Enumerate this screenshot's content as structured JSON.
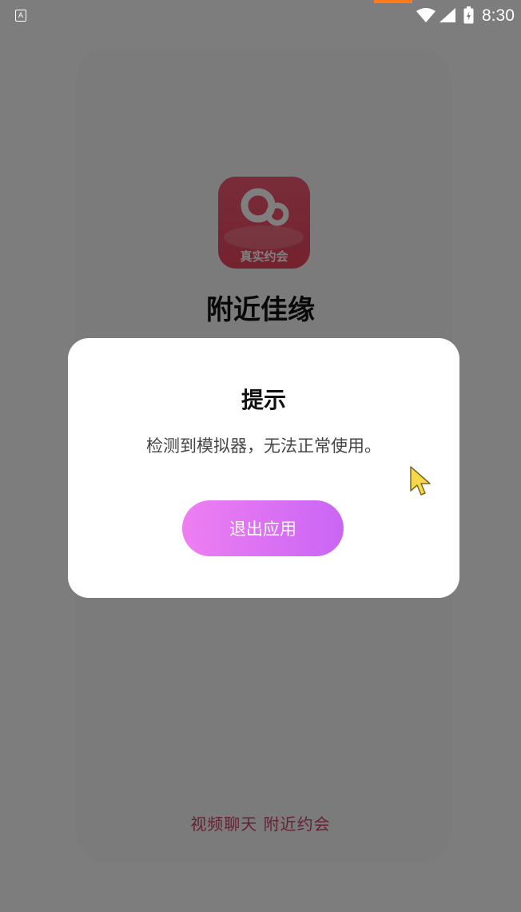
{
  "status_bar": {
    "notification_icon": "A",
    "time": "8:30",
    "icons": [
      "a-notification-icon",
      "wifi-icon",
      "signal-icon",
      "battery-icon"
    ]
  },
  "splash": {
    "logo_label": "真实约会",
    "app_name": "附近佳缘",
    "slogan": "视频聊天 附近约会"
  },
  "dialog": {
    "title": "提示",
    "message": "检测到模拟器，无法正常使用。",
    "exit_button_label": "退出应用"
  },
  "colors": {
    "accent_gradient_start": "#ee7ff2",
    "accent_gradient_end": "#ca66f4",
    "logo_red": "#e7445c",
    "slogan": "#c9446a"
  }
}
